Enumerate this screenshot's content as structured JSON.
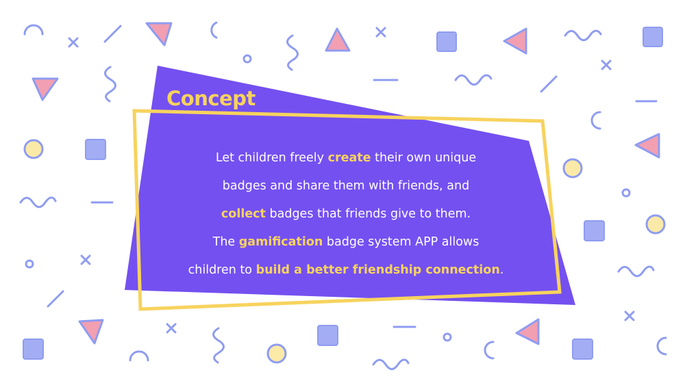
{
  "title": "Concept",
  "colors": {
    "panel": "#7450f0",
    "accent_yellow": "#f7d35e",
    "shape_blue": "#8f9cf0",
    "shape_pink": "#f29fb2",
    "shape_cream": "#fbeaa7",
    "text": "#ffffff"
  },
  "body": {
    "line1": {
      "before": "Let children freely ",
      "highlight": "create",
      "after": " their own unique"
    },
    "line2": {
      "text": "badges and share them with friends, and"
    },
    "line3": {
      "highlight": "collect",
      "after": " badges that friends give to them."
    },
    "line4": {
      "before": "The ",
      "highlight": "gamification",
      "after": " badge system APP allows"
    },
    "line5": {
      "before": "children to ",
      "highlight": "build a better friendship connection",
      "after": "."
    }
  },
  "decorations": [
    "arc-icon",
    "x-icon",
    "slash-icon",
    "triangle-icon",
    "square-icon",
    "circle-icon",
    "ring-icon",
    "zigzag-icon",
    "wave-icon",
    "dash-icon",
    "crescent-icon"
  ]
}
